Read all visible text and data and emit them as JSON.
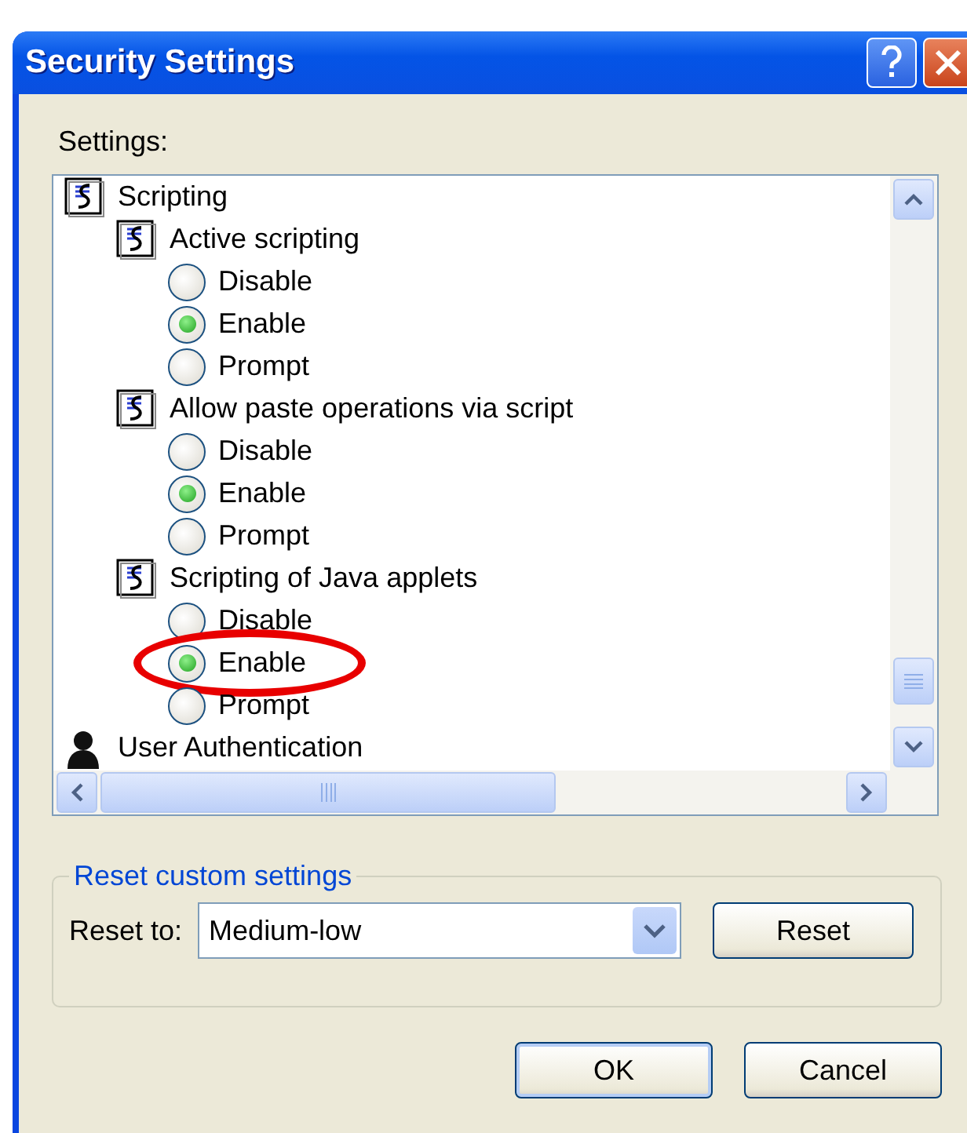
{
  "window": {
    "title": "Security Settings"
  },
  "settings_label": "Settings:",
  "tree": [
    {
      "label": "Scripting",
      "kind": "category",
      "children": [
        {
          "label": "Active scripting",
          "options": [
            {
              "label": "Disable",
              "selected": false,
              "highlighted": false
            },
            {
              "label": "Enable",
              "selected": true,
              "highlighted": false
            },
            {
              "label": "Prompt",
              "selected": false,
              "highlighted": false
            }
          ]
        },
        {
          "label": "Allow paste operations via script",
          "options": [
            {
              "label": "Disable",
              "selected": false,
              "highlighted": false
            },
            {
              "label": "Enable",
              "selected": true,
              "highlighted": false
            },
            {
              "label": "Prompt",
              "selected": false,
              "highlighted": false
            }
          ]
        },
        {
          "label": "Scripting of Java applets",
          "options": [
            {
              "label": "Disable",
              "selected": false,
              "highlighted": false
            },
            {
              "label": "Enable",
              "selected": true,
              "highlighted": true
            },
            {
              "label": "Prompt",
              "selected": false,
              "highlighted": false
            }
          ]
        }
      ]
    },
    {
      "label": "User Authentication",
      "kind": "user"
    }
  ],
  "reset_group": {
    "title": "Reset custom settings",
    "label": "Reset to:",
    "value": "Medium-low",
    "button": "Reset"
  },
  "buttons": [
    "OK",
    "Cancel"
  ]
}
